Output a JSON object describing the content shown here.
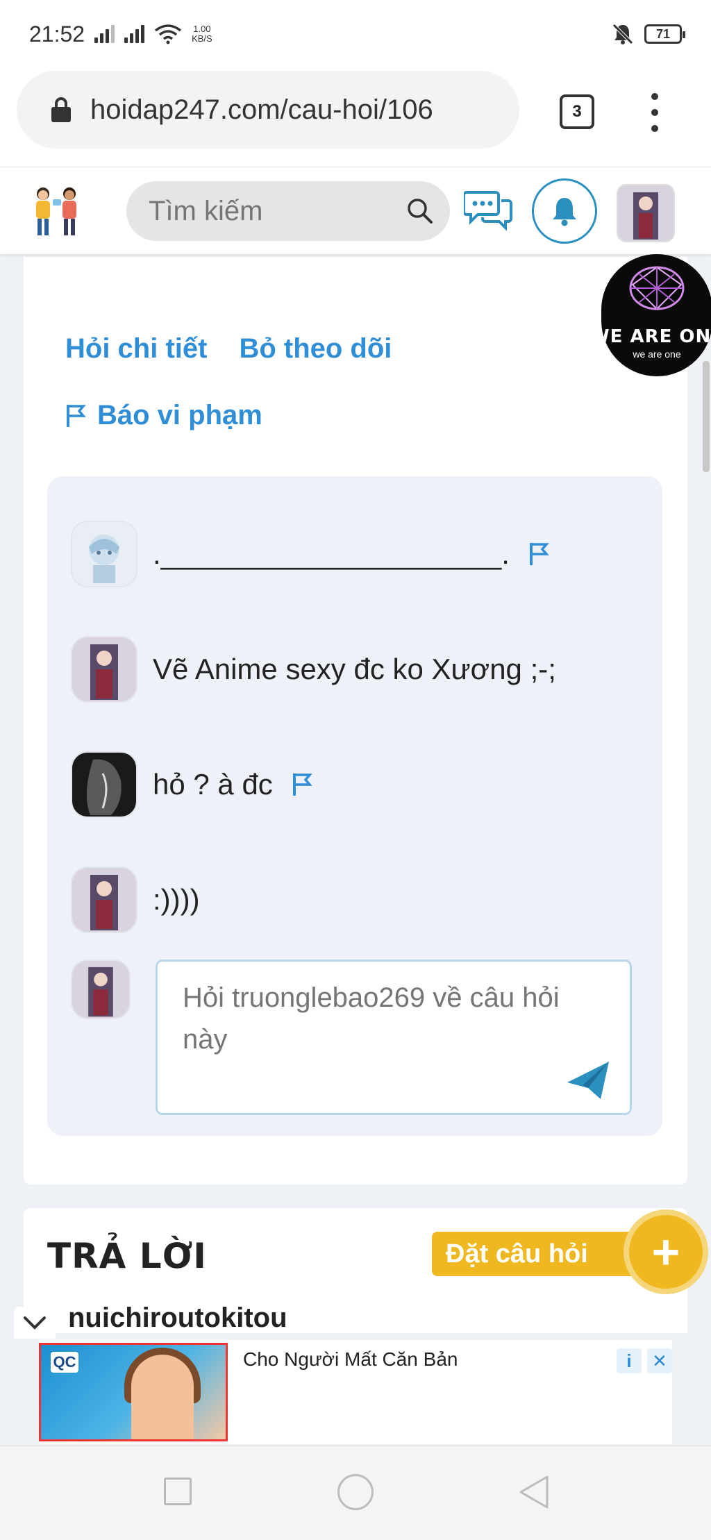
{
  "statusbar": {
    "time": "21:52",
    "net_speed_top": "1.00",
    "net_speed_bottom": "KB/S",
    "battery": "71"
  },
  "browser": {
    "url": "hoidap247.com/cau-hoi/106",
    "tab_count": "3"
  },
  "site_header": {
    "search_placeholder": "Tìm kiếm"
  },
  "question_actions": {
    "ask_detail": "Hỏi chi tiết",
    "unfollow": "Bỏ theo dõi",
    "report": "Báo vi phạm"
  },
  "comments": [
    {
      "text": "._____________________.",
      "has_report": true
    },
    {
      "text": "Vẽ Anime sexy đc ko Xương ;-;",
      "has_report": false
    },
    {
      "text": "hỏ ? à đc",
      "has_report": true
    },
    {
      "text": ":))))",
      "has_report": false
    }
  ],
  "reply": {
    "placeholder": "Hỏi truonglebao269 về câu hỏi này"
  },
  "answers": {
    "heading": "TRẢ LỜI",
    "ask_button": "Đặt câu hỏi",
    "plus": "+",
    "first_author": "nuichiroutokitou"
  },
  "overlay": {
    "line1": "WE ARE ONE",
    "line2": "we are one"
  },
  "ad": {
    "badge": "QC",
    "title": "Cho Người Mất Căn Bản",
    "info_icon": "i",
    "close_icon": "✕"
  },
  "colors": {
    "link_blue": "#2f8ed6",
    "accent_yellow": "#f0b820",
    "bell_blue": "#2b8fbf"
  }
}
